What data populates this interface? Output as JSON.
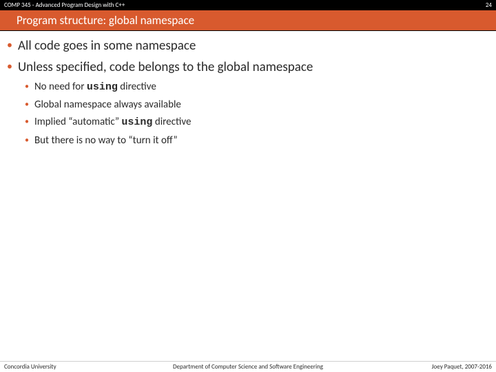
{
  "header": {
    "course": "COMP 345 - Advanced Program Design with C++",
    "page_no": "24"
  },
  "title": "Program structure: global namespace",
  "bullets_l1": [
    "All code goes in some namespace",
    "Unless specified, code belongs to the global namespace"
  ],
  "bullets_l2": [
    {
      "pre": "No need for ",
      "kw": "using",
      "post": " directive"
    },
    {
      "pre": "Global namespace always available",
      "kw": "",
      "post": ""
    },
    {
      "pre": "Implied “automatic” ",
      "kw": "using",
      "post": "  directive"
    },
    {
      "pre": "But there is no way to “turn it off”",
      "kw": "",
      "post": ""
    }
  ],
  "footer": {
    "left": "Concordia University",
    "center": "Department of Computer Science and Software Engineering",
    "right": "Joey Paquet, 2007-2016"
  }
}
